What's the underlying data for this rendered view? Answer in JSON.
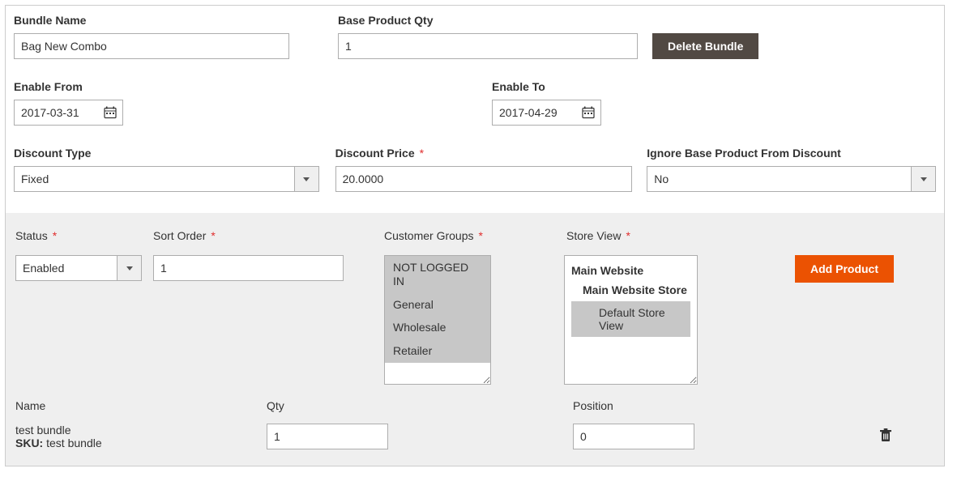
{
  "bundle_name_label": "Bundle Name",
  "bundle_name_value": "Bag New Combo",
  "base_qty_label": "Base Product Qty",
  "base_qty_value": "1",
  "delete_bundle_label": "Delete Bundle",
  "enable_from_label": "Enable From",
  "enable_from_value": "2017-03-31",
  "enable_to_label": "Enable To",
  "enable_to_value": "2017-04-29",
  "discount_type_label": "Discount Type",
  "discount_type_value": "Fixed",
  "discount_price_label": "Discount Price",
  "discount_price_value": "20.0000",
  "ignore_base_label": "Ignore Base Product From Discount",
  "ignore_base_value": "No",
  "status_label": "Status",
  "status_value": "Enabled",
  "sort_order_label": "Sort Order",
  "sort_order_value": "1",
  "customer_groups_label": "Customer Groups",
  "customer_groups": [
    "NOT LOGGED IN",
    "General",
    "Wholesale",
    "Retailer"
  ],
  "store_view_label": "Store View",
  "store_view": {
    "website": "Main Website",
    "store": "Main Website Store",
    "view": "Default Store View"
  },
  "add_product_label": "Add Product",
  "product_table": {
    "headers": {
      "name": "Name",
      "qty": "Qty",
      "position": "Position"
    },
    "row": {
      "name": "test bundle",
      "sku_label": "SKU:",
      "sku": "test bundle",
      "qty": "1",
      "position": "0"
    }
  }
}
